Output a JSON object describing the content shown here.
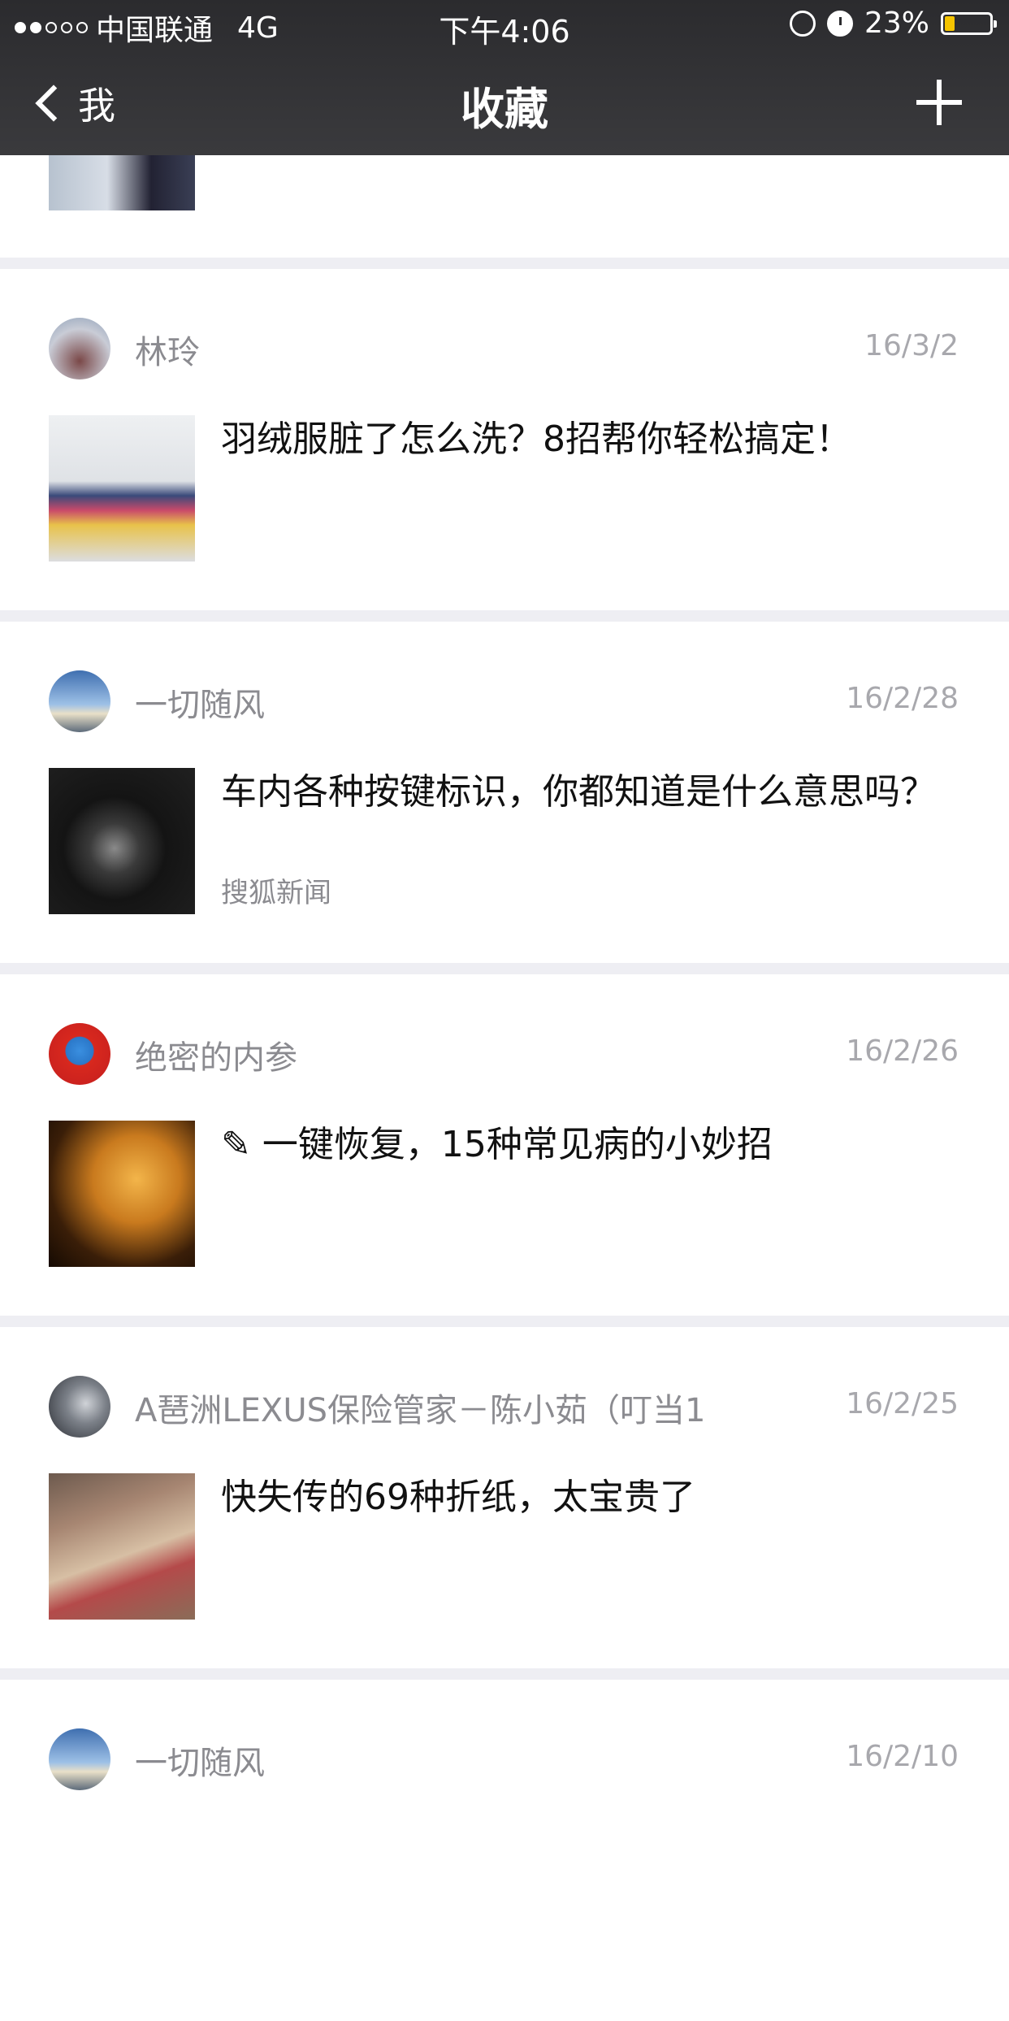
{
  "status_bar": {
    "carrier": "中国联通",
    "network": "4G",
    "time": "下午4:06",
    "battery": "23%",
    "battery_level": 0.23
  },
  "nav": {
    "back_label": "我",
    "title": "收藏"
  },
  "items": [
    {
      "sender": "林玲",
      "date": "16/3/2",
      "title": "羽绒服脏了怎么洗？8招帮你轻松搞定！",
      "source": ""
    },
    {
      "sender": "一切随风",
      "date": "16/2/28",
      "title": "车内各种按键标识，你都知道是什么意思吗？",
      "source": "搜狐新闻"
    },
    {
      "sender": "绝密的内参",
      "date": "16/2/26",
      "title": "✎ 一键恢复，15种常见病的小妙招",
      "source": ""
    },
    {
      "sender": "A琶洲LEXUS保险管家－陈小茹（叮当1",
      "date": "16/2/25",
      "title": "快失传的69种折纸，太宝贵了",
      "source": ""
    },
    {
      "sender": "一切随风",
      "date": "16/2/10",
      "title": "",
      "source": ""
    }
  ],
  "colors": {
    "nav_bg": "#2b2b2e",
    "battery": "#f5c400",
    "page_bg": "#eeeef3"
  }
}
